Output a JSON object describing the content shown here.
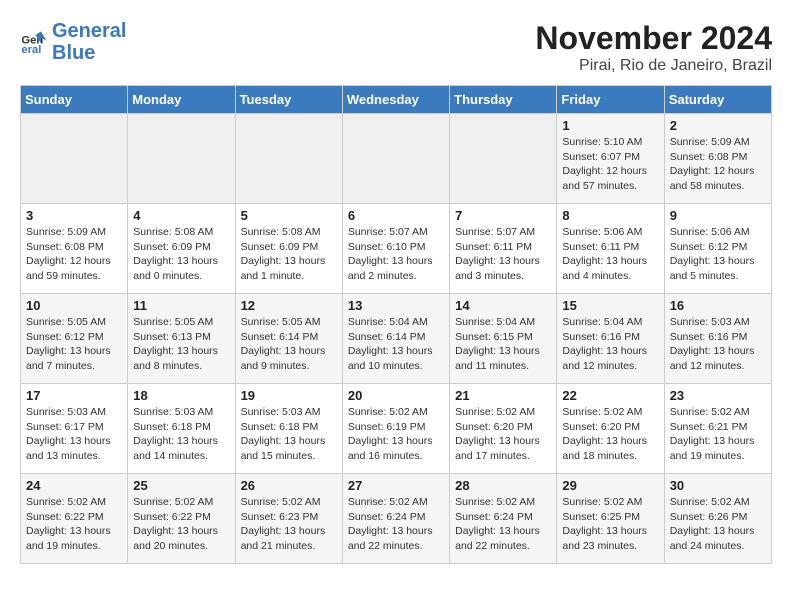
{
  "logo": {
    "line1": "General",
    "line2": "Blue"
  },
  "title": "November 2024",
  "subtitle": "Pirai, Rio de Janeiro, Brazil",
  "days_of_week": [
    "Sunday",
    "Monday",
    "Tuesday",
    "Wednesday",
    "Thursday",
    "Friday",
    "Saturday"
  ],
  "weeks": [
    [
      {
        "day": "",
        "info": ""
      },
      {
        "day": "",
        "info": ""
      },
      {
        "day": "",
        "info": ""
      },
      {
        "day": "",
        "info": ""
      },
      {
        "day": "",
        "info": ""
      },
      {
        "day": "1",
        "info": "Sunrise: 5:10 AM\nSunset: 6:07 PM\nDaylight: 12 hours and 57 minutes."
      },
      {
        "day": "2",
        "info": "Sunrise: 5:09 AM\nSunset: 6:08 PM\nDaylight: 12 hours and 58 minutes."
      }
    ],
    [
      {
        "day": "3",
        "info": "Sunrise: 5:09 AM\nSunset: 6:08 PM\nDaylight: 12 hours and 59 minutes."
      },
      {
        "day": "4",
        "info": "Sunrise: 5:08 AM\nSunset: 6:09 PM\nDaylight: 13 hours and 0 minutes."
      },
      {
        "day": "5",
        "info": "Sunrise: 5:08 AM\nSunset: 6:09 PM\nDaylight: 13 hours and 1 minute."
      },
      {
        "day": "6",
        "info": "Sunrise: 5:07 AM\nSunset: 6:10 PM\nDaylight: 13 hours and 2 minutes."
      },
      {
        "day": "7",
        "info": "Sunrise: 5:07 AM\nSunset: 6:11 PM\nDaylight: 13 hours and 3 minutes."
      },
      {
        "day": "8",
        "info": "Sunrise: 5:06 AM\nSunset: 6:11 PM\nDaylight: 13 hours and 4 minutes."
      },
      {
        "day": "9",
        "info": "Sunrise: 5:06 AM\nSunset: 6:12 PM\nDaylight: 13 hours and 5 minutes."
      }
    ],
    [
      {
        "day": "10",
        "info": "Sunrise: 5:05 AM\nSunset: 6:12 PM\nDaylight: 13 hours and 7 minutes."
      },
      {
        "day": "11",
        "info": "Sunrise: 5:05 AM\nSunset: 6:13 PM\nDaylight: 13 hours and 8 minutes."
      },
      {
        "day": "12",
        "info": "Sunrise: 5:05 AM\nSunset: 6:14 PM\nDaylight: 13 hours and 9 minutes."
      },
      {
        "day": "13",
        "info": "Sunrise: 5:04 AM\nSunset: 6:14 PM\nDaylight: 13 hours and 10 minutes."
      },
      {
        "day": "14",
        "info": "Sunrise: 5:04 AM\nSunset: 6:15 PM\nDaylight: 13 hours and 11 minutes."
      },
      {
        "day": "15",
        "info": "Sunrise: 5:04 AM\nSunset: 6:16 PM\nDaylight: 13 hours and 12 minutes."
      },
      {
        "day": "16",
        "info": "Sunrise: 5:03 AM\nSunset: 6:16 PM\nDaylight: 13 hours and 12 minutes."
      }
    ],
    [
      {
        "day": "17",
        "info": "Sunrise: 5:03 AM\nSunset: 6:17 PM\nDaylight: 13 hours and 13 minutes."
      },
      {
        "day": "18",
        "info": "Sunrise: 5:03 AM\nSunset: 6:18 PM\nDaylight: 13 hours and 14 minutes."
      },
      {
        "day": "19",
        "info": "Sunrise: 5:03 AM\nSunset: 6:18 PM\nDaylight: 13 hours and 15 minutes."
      },
      {
        "day": "20",
        "info": "Sunrise: 5:02 AM\nSunset: 6:19 PM\nDaylight: 13 hours and 16 minutes."
      },
      {
        "day": "21",
        "info": "Sunrise: 5:02 AM\nSunset: 6:20 PM\nDaylight: 13 hours and 17 minutes."
      },
      {
        "day": "22",
        "info": "Sunrise: 5:02 AM\nSunset: 6:20 PM\nDaylight: 13 hours and 18 minutes."
      },
      {
        "day": "23",
        "info": "Sunrise: 5:02 AM\nSunset: 6:21 PM\nDaylight: 13 hours and 19 minutes."
      }
    ],
    [
      {
        "day": "24",
        "info": "Sunrise: 5:02 AM\nSunset: 6:22 PM\nDaylight: 13 hours and 19 minutes."
      },
      {
        "day": "25",
        "info": "Sunrise: 5:02 AM\nSunset: 6:22 PM\nDaylight: 13 hours and 20 minutes."
      },
      {
        "day": "26",
        "info": "Sunrise: 5:02 AM\nSunset: 6:23 PM\nDaylight: 13 hours and 21 minutes."
      },
      {
        "day": "27",
        "info": "Sunrise: 5:02 AM\nSunset: 6:24 PM\nDaylight: 13 hours and 22 minutes."
      },
      {
        "day": "28",
        "info": "Sunrise: 5:02 AM\nSunset: 6:24 PM\nDaylight: 13 hours and 22 minutes."
      },
      {
        "day": "29",
        "info": "Sunrise: 5:02 AM\nSunset: 6:25 PM\nDaylight: 13 hours and 23 minutes."
      },
      {
        "day": "30",
        "info": "Sunrise: 5:02 AM\nSunset: 6:26 PM\nDaylight: 13 hours and 24 minutes."
      }
    ]
  ]
}
